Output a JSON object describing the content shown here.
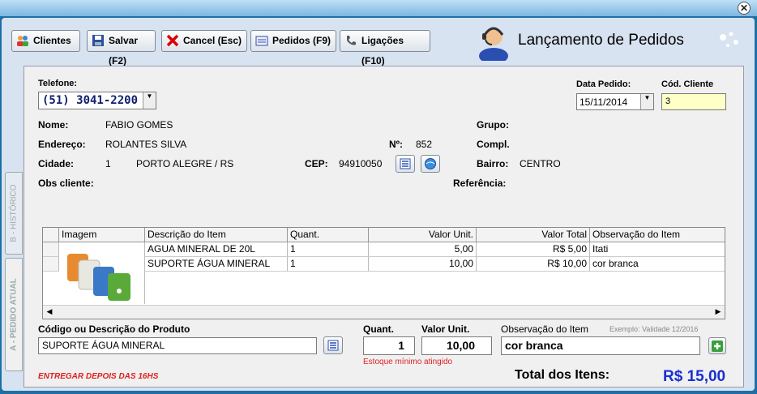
{
  "toolbar": {
    "clientes": "Clientes",
    "salvar": "Salvar (F2)",
    "cancel": "Cancel (Esc)",
    "pedidos": "Pedidos (F9)",
    "ligacoes": "Ligações (F10)"
  },
  "header": {
    "title": "Lançamento de Pedidos"
  },
  "tabs": {
    "historico": "B - HISTÓRICO",
    "pedido_atual": "A - PEDIDO ATUAL"
  },
  "customer": {
    "telefone_label": "Telefone:",
    "telefone": "(51) 3041-2200",
    "data_pedido_label": "Data Pedido:",
    "data_pedido": "15/11/2014",
    "cod_cliente_label": "Cód. Cliente",
    "cod_cliente": "3",
    "nome_label": "Nome:",
    "nome": "FABIO GOMES",
    "grupo_label": "Grupo:",
    "endereco_label": "Endereço:",
    "endereco": "ROLANTES SILVA",
    "numero_label": "Nº:",
    "numero": "852",
    "compl_label": "Compl.",
    "cidade_label": "Cidade:",
    "cidade_cod": "1",
    "cidade": "PORTO ALEGRE / RS",
    "cep_label": "CEP:",
    "cep": "94910050",
    "bairro_label": "Bairro:",
    "bairro": "CENTRO",
    "obs_label": "Obs cliente:",
    "referencia_label": "Referência:"
  },
  "grid": {
    "headers": [
      "Imagem",
      "Descrição do Item",
      "Quant.",
      "Valor Unit.",
      "Valor Total",
      "Observação do Item"
    ],
    "rows": [
      {
        "descricao": "AGUA MINERAL DE 20L",
        "quant": "1",
        "unit": "5,00",
        "total": "R$ 5,00",
        "obs": "Itati"
      },
      {
        "descricao": "SUPORTE ÁGUA MINERAL",
        "quant": "1",
        "unit": "10,00",
        "total": "R$ 10,00",
        "obs": "cor branca"
      }
    ]
  },
  "entry": {
    "produto_label": "Código ou Descrição do Produto",
    "produto": "SUPORTE ÁGUA MINERAL",
    "quant_label": "Quant.",
    "quant": "1",
    "unit_label": "Valor Unit.",
    "unit": "10,00",
    "obs_label": "Observação do Item",
    "exemplo": "Exemplo: Validade 12/2016",
    "obs": "cor branca",
    "estoque": "Estoque mínimo atingido"
  },
  "footer": {
    "nota": "ENTREGAR DEPOIS DAS 16HS",
    "total_label": "Total dos Itens:",
    "total": "R$ 15,00"
  },
  "colors": {
    "accent_total": "#1a2fd0",
    "warning": "#e02020",
    "cod_bg": "#ffffc8"
  }
}
